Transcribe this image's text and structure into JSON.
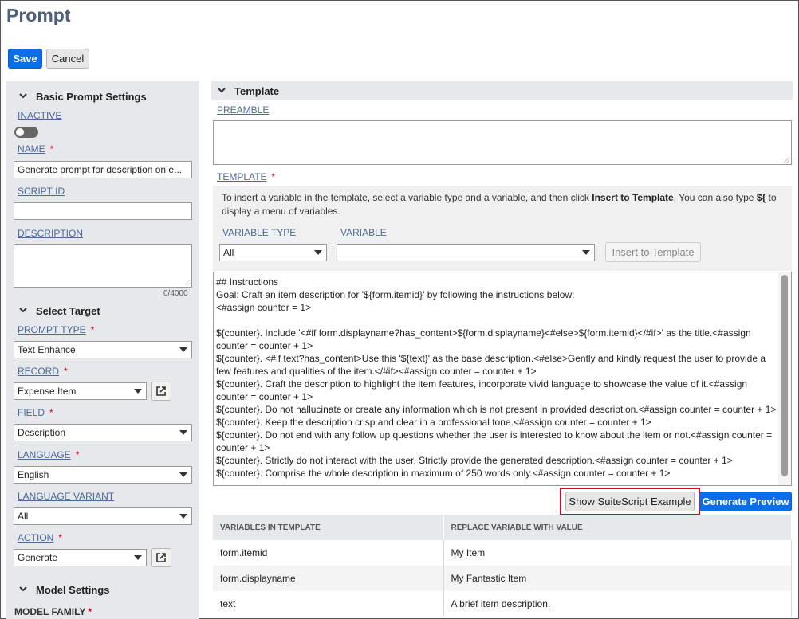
{
  "page": {
    "title": "Prompt"
  },
  "toolbar": {
    "save_label": "Save",
    "cancel_label": "Cancel"
  },
  "basic_settings": {
    "section_title": "Basic Prompt Settings",
    "inactive_label": "INACTIVE",
    "name_label": "NAME",
    "name_value": "Generate prompt for description on e...",
    "script_id_label": "SCRIPT ID",
    "script_id_value": "",
    "description_label": "DESCRIPTION",
    "description_value": "",
    "description_counter": "0/4000"
  },
  "select_target": {
    "section_title": "Select Target",
    "prompt_type_label": "PROMPT TYPE",
    "prompt_type_value": "Text Enhance",
    "record_label": "RECORD",
    "record_value": "Expense Item",
    "field_label": "FIELD",
    "field_value": "Description",
    "language_label": "LANGUAGE",
    "language_value": "English",
    "language_variant_label": "LANGUAGE VARIANT",
    "language_variant_value": "All",
    "action_label": "ACTION",
    "action_value": "Generate"
  },
  "model_settings": {
    "section_title": "Model Settings",
    "model_family_label": "MODEL FAMILY"
  },
  "template": {
    "section_title": "Template",
    "preamble_label": "PREAMBLE",
    "template_label": "TEMPLATE",
    "help_text_1": "To insert a variable in the template, select a variable type and a variable, and then click ",
    "help_text_bold_1": "Insert to Template",
    "help_text_2": ". You can also type ",
    "help_text_bold_2": "${",
    "help_text_3": " to display a menu of variables.",
    "variable_type_label": "VARIABLE TYPE",
    "variable_type_value": "All",
    "variable_label": "VARIABLE",
    "variable_value": "",
    "insert_button": "Insert to Template",
    "content": "## Instructions\nGoal: Craft an item description for '${form.itemid}' by following the instructions below:\n<#assign counter = 1>\n\n${counter}. Include '<#if form.displayname?has_content>${form.displayname}<#else>${form.itemid}</#if>' as the title.<#assign counter = counter + 1>\n${counter}. <#if text?has_content>Use this '${text}' as the base description.<#else>Gently and kindly request the user to provide a few features and qualities of the item.</#if><#assign counter = counter + 1>\n${counter}. Craft the description to highlight the item features, incorporate vivid language to showcase the value of it.<#assign counter = counter + 1>\n${counter}. Do not hallucinate or create any information which is not present in provided description.<#assign counter = counter + 1>\n${counter}. Keep the description crisp and clear in a professional tone.<#assign counter = counter + 1>\n${counter}. Do not end with any follow up questions whether the user is interested to know about the item or not.<#assign counter = counter + 1>\n${counter}. Strictly do not interact with the user. Strictly provide the generated description.<#assign counter = counter + 1>\n${counter}. Comprise the whole description in maximum of 250 words only.<#assign counter = counter + 1>"
  },
  "actions": {
    "show_example": "Show SuiteScript Example",
    "generate_preview": "Generate Preview"
  },
  "variables_table": {
    "headers": [
      "VARIABLES IN TEMPLATE",
      "REPLACE VARIABLE WITH VALUE"
    ],
    "rows": [
      [
        "form.itemid",
        "My Item"
      ],
      [
        "form.displayname",
        "My Fantastic Item"
      ],
      [
        "text",
        "A brief item description."
      ]
    ]
  },
  "colors": {
    "primary": "#0a6ee8",
    "title": "#4d5f79",
    "panel": "#e6e8ec",
    "required": "#d0021b",
    "highlight": "#d9001b"
  },
  "icons": [
    "chevron-down-icon",
    "toggle-switch",
    "external-link-icon",
    "dropdown-arrow-icon"
  ]
}
